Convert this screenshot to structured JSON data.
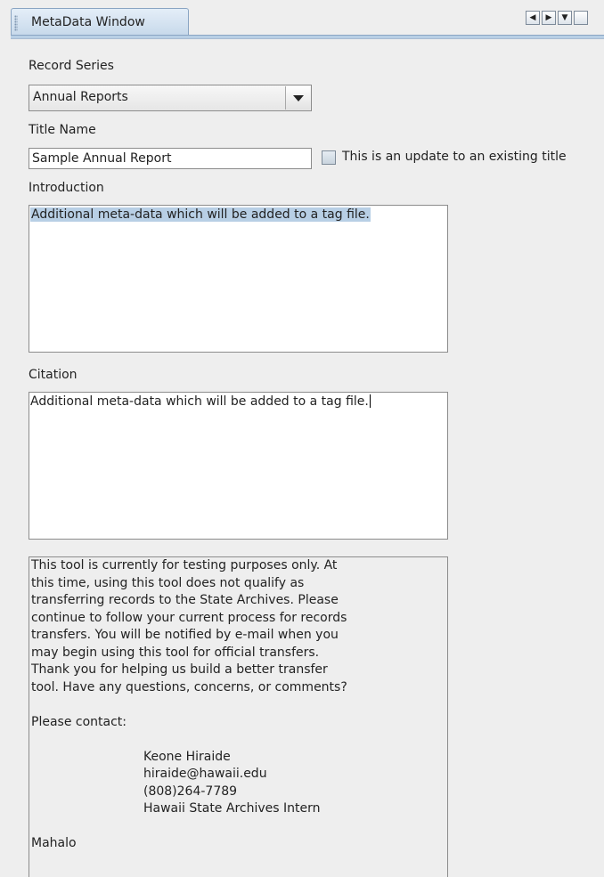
{
  "window": {
    "tab_title": "MetaData Window",
    "tab_controls": {
      "prev_icon": "◀",
      "next_icon": "▶",
      "menu_icon": "▼"
    }
  },
  "form": {
    "record_series": {
      "label": "Record Series",
      "selected": "Annual Reports"
    },
    "title_name": {
      "label": "Title Name",
      "value": "Sample Annual Report",
      "update_checkbox_label": "This is an update to an existing title",
      "update_checked": false
    },
    "introduction": {
      "label": "Introduction",
      "value": "Additional meta-data which will be added to a tag file."
    },
    "citation": {
      "label": "Citation",
      "value": "Additional meta-data which will be added to a tag file."
    }
  },
  "notice": {
    "lines": [
      "This tool is currently for testing purposes only. At",
      "this time, using this tool does not qualify as",
      "transferring records to the State Archives. Please",
      "continue to follow your current process for records",
      "transfers. You will be notified by e-mail when you",
      "may begin using this tool for official transfers.",
      "Thank you for helping us build a better transfer",
      "tool. Have any questions, concerns, or comments?"
    ],
    "contact_prompt": "Please contact:",
    "contact": {
      "name": "Keone Hiraide",
      "email": "hiraide@hawaii.edu",
      "phone": "(808)264-7789",
      "role": "Hawaii State Archives Intern"
    },
    "signoff": "Mahalo"
  },
  "colors": {
    "background": "#eeeeee",
    "selection": "#b8cfe5",
    "tab_accent": "#c6d8ea"
  }
}
